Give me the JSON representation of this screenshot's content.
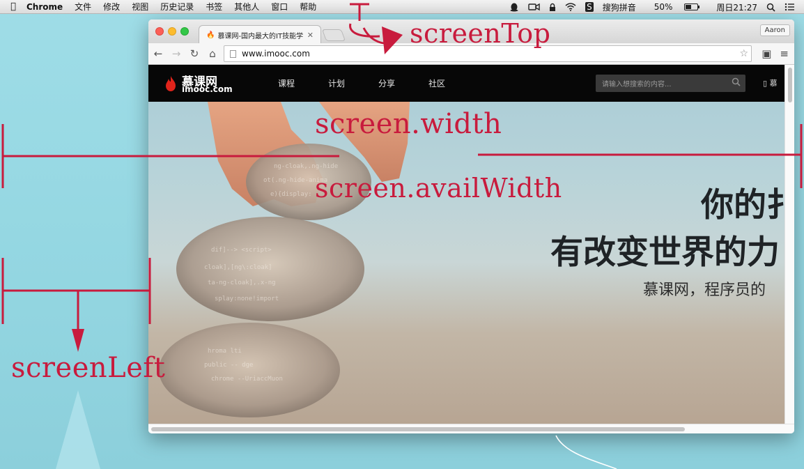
{
  "menubar": {
    "app_name": "Chrome",
    "items": [
      "文件",
      "修改",
      "视图",
      "历史记录",
      "书签",
      "其他人",
      "窗口",
      "帮助"
    ],
    "input_method": "搜狗拼音",
    "battery_text": "50%",
    "battery_level": 0.5,
    "clock": "周日21:27"
  },
  "browser": {
    "tab_title": "慕课网-国内最大的IT技能学",
    "profile_name": "Aaron",
    "url": "www.imooc.com"
  },
  "site": {
    "logo_name": "慕课网",
    "logo_domain": "imooc.com",
    "nav": [
      "课程",
      "计划",
      "分享",
      "社区"
    ],
    "search_placeholder": "请输入想搜索的内容...",
    "right_text": "慕"
  },
  "hero": {
    "headline1": "你的扌",
    "headline2": "有改变世界的力",
    "subline": "慕课网，程序员的"
  },
  "annotations": {
    "screen_top": "screenTop",
    "screen_width": "screen.width",
    "screen_avail_width": "screen.availWidth",
    "screen_left": "screenLeft",
    "color": "#c81b3d"
  }
}
